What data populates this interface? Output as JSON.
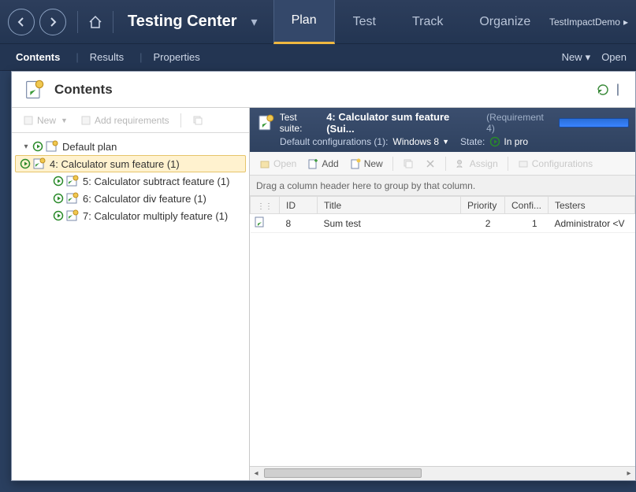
{
  "topbar": {
    "title": "Testing Center",
    "tabs": [
      "Plan",
      "Test",
      "Track",
      "Organize"
    ],
    "active_tab": "Plan",
    "project": "TestImpactDemo"
  },
  "subbar": {
    "tabs": [
      "Contents",
      "Results",
      "Properties"
    ],
    "active": "Contents",
    "right": {
      "new": "New",
      "open": "Open"
    }
  },
  "panel": {
    "title": "Contents"
  },
  "tree_toolbar": {
    "new": "New",
    "add_req": "Add requirements"
  },
  "tree": {
    "root": "Default plan",
    "items": [
      {
        "label": "4: Calculator sum feature (1)",
        "selected": true
      },
      {
        "label": "5: Calculator subtract feature (1)",
        "selected": false
      },
      {
        "label": "6: Calculator div feature (1)",
        "selected": false
      },
      {
        "label": "7: Calculator multiply feature (1)",
        "selected": false
      }
    ]
  },
  "suite": {
    "label": "Test suite:",
    "title": "4: Calculator sum feature (Sui...",
    "requirement": "(Requirement 4)",
    "config_label": "Default configurations (1):",
    "config_value": "Windows 8",
    "state_label": "State:",
    "state_value": "In pro"
  },
  "grid_toolbar": {
    "open": "Open",
    "add": "Add",
    "new": "New",
    "assign": "Assign",
    "configurations": "Configurations"
  },
  "group_hint": "Drag a column header here to group by that column.",
  "grid": {
    "columns": [
      "",
      "ID",
      "Title",
      "Priority",
      "Confi...",
      "Testers"
    ],
    "rows": [
      {
        "id": "8",
        "title": "Sum test",
        "priority": "2",
        "config": "1",
        "testers": "Administrator <V"
      }
    ]
  }
}
